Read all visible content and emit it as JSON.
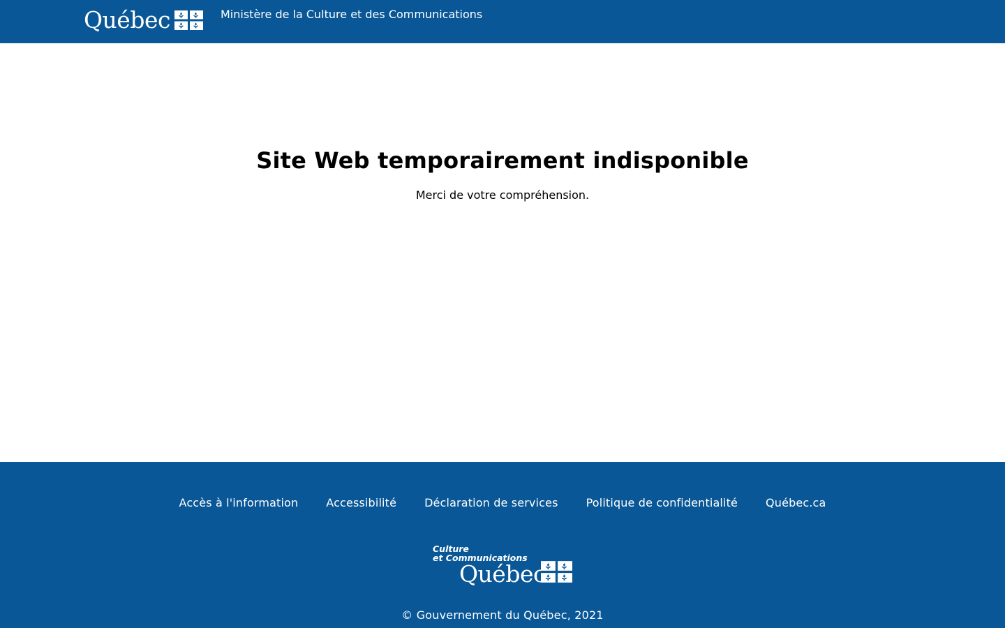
{
  "header": {
    "brand_wordmark": "Québec",
    "flag_icon": "quebec-flag-icon",
    "ministry_name": "Ministère de la Culture et des Communications"
  },
  "main": {
    "title": "Site Web temporairement indisponible",
    "message": "Merci de votre compréhension."
  },
  "footer": {
    "links": [
      "Accès à l'information",
      "Accessibilité",
      "Déclaration de services",
      "Politique de confidentialité",
      "Québec.ca"
    ],
    "logo": {
      "line1": "Culture",
      "line2": "et Communications",
      "wordmark": "Québec"
    },
    "copyright": "© Gouvernement du Québec, 2021"
  },
  "colors": {
    "brand_blue": "#095797",
    "text_white": "#ffffff",
    "text_dark": "#000000"
  }
}
